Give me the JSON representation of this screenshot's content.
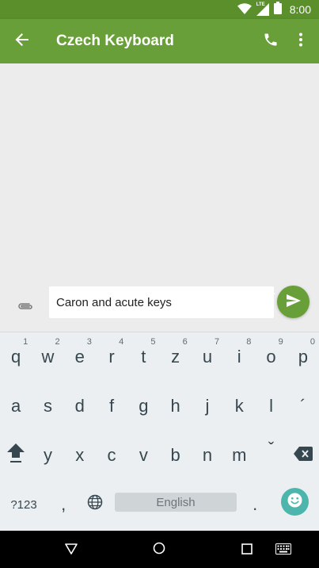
{
  "status_bar": {
    "time": "8:00",
    "network_label": "LTE"
  },
  "app_bar": {
    "title": "Czech Keyboard",
    "back_icon": "arrow-left-icon",
    "call_icon": "phone-icon",
    "menu_icon": "more-vertical-icon"
  },
  "compose": {
    "attach_icon": "paperclip-icon",
    "message_value": "Caron and acute keys",
    "send_icon": "send-icon"
  },
  "keyboard": {
    "row1": [
      {
        "label": "q",
        "hint": "1"
      },
      {
        "label": "w",
        "hint": "2"
      },
      {
        "label": "e",
        "hint": "3"
      },
      {
        "label": "r",
        "hint": "4"
      },
      {
        "label": "t",
        "hint": "5"
      },
      {
        "label": "z",
        "hint": "6"
      },
      {
        "label": "u",
        "hint": "7"
      },
      {
        "label": "i",
        "hint": "8"
      },
      {
        "label": "o",
        "hint": "9"
      },
      {
        "label": "p",
        "hint": "0"
      }
    ],
    "row2": [
      "a",
      "s",
      "d",
      "f",
      "g",
      "h",
      "j",
      "k",
      "l",
      "´"
    ],
    "row3": [
      "y",
      "x",
      "c",
      "v",
      "b",
      "n",
      "m",
      "ˇ"
    ],
    "symbols_label": "?123",
    "comma_label": ",",
    "space_label": "English",
    "period_label": ".",
    "shift_icon": "shift-icon",
    "backspace_icon": "backspace-icon",
    "globe_icon": "globe-icon",
    "emoji_icon": "emoji-icon"
  },
  "nav_bar": {
    "back_icon": "nav-back-triangle-icon",
    "home_icon": "nav-home-circle-icon",
    "recents_icon": "nav-recents-square-icon",
    "keyboard_icon": "keyboard-switch-icon"
  },
  "colors": {
    "primary": "#689f38",
    "primary_dark": "#5a8f2c",
    "keyboard_bg": "#eceff1",
    "emoji_accent": "#4db6ac"
  }
}
